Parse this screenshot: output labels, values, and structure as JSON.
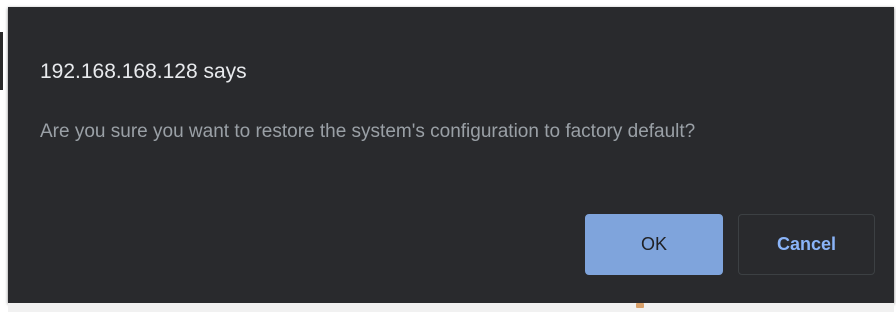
{
  "dialog": {
    "title": "192.168.168.128 says",
    "message": "Are you sure you want to restore the system's configuration to factory default?",
    "buttons": {
      "ok_label": "OK",
      "cancel_label": "Cancel"
    }
  },
  "colors": {
    "dialog_background": "#292a2d",
    "title_text": "#e8eaed",
    "message_text": "#9aa0a6",
    "ok_button_background": "#7fa4dc",
    "cancel_button_text": "#8ab4f8"
  }
}
